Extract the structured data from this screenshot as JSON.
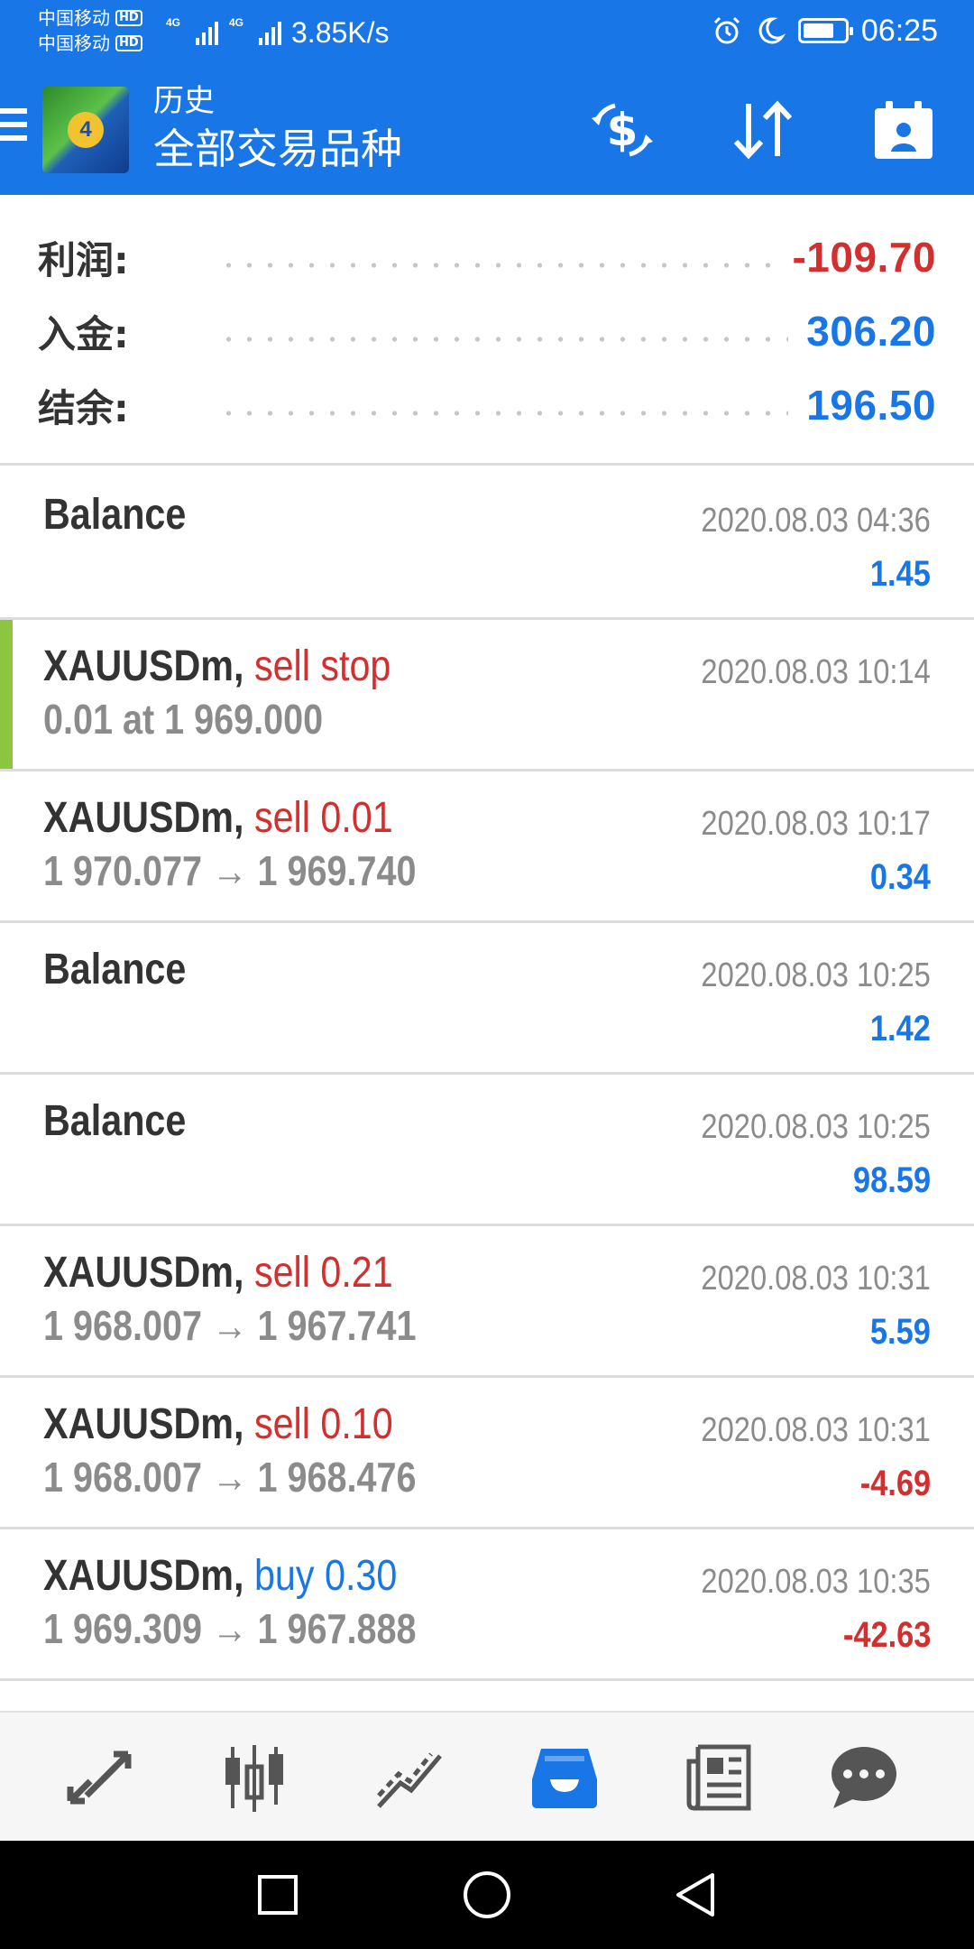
{
  "status_bar": {
    "carrier_1": "中国移动",
    "carrier_2": "中国移动",
    "hd_badge": "HD",
    "network_1": "4G",
    "network_2": "4G",
    "net_speed": "3.85K/s",
    "time": "06:25",
    "battery_level": 0.75,
    "icons": [
      "alarm-icon",
      "moon-icon",
      "battery-icon"
    ]
  },
  "app_bar": {
    "subtitle": "历史",
    "title": "全部交易品种",
    "logo_text": "4",
    "icons": [
      "menu-icon",
      "deposit-icon",
      "sort-icon",
      "period-icon"
    ]
  },
  "summary": {
    "rows": [
      {
        "label": "利润:",
        "value": "-109.70",
        "color": "#d32f2f"
      },
      {
        "label": "入金:",
        "value": "306.20",
        "color": "#1976e6"
      },
      {
        "label": "结余:",
        "value": "196.50",
        "color": "#1976e6"
      }
    ]
  },
  "colors": {
    "accent_blue": "#1976e6",
    "loss_red": "#d32f2f",
    "pending_green": "#8cc63f",
    "muted_gray": "#8b8b8b"
  },
  "deals": [
    {
      "type": "balance",
      "symbol": "Balance",
      "action": "",
      "detail": "",
      "time": "2020.08.03 04:36",
      "profit": "1.45",
      "profit_color": "#1976e6",
      "action_color": ""
    },
    {
      "type": "order",
      "symbol": "XAUUSDm,",
      "action": "sell stop",
      "detail": "0.01 at 1 969.000",
      "time": "2020.08.03 10:14",
      "profit": "",
      "profit_color": "",
      "action_color": "#d32f2f"
    },
    {
      "type": "deal",
      "symbol": "XAUUSDm,",
      "action": "sell 0.01",
      "detail": "1 970.077 → 1 969.740",
      "time": "2020.08.03 10:17",
      "profit": "0.34",
      "profit_color": "#1976e6",
      "action_color": "#d32f2f"
    },
    {
      "type": "balance",
      "symbol": "Balance",
      "action": "",
      "detail": "",
      "time": "2020.08.03 10:25",
      "profit": "1.42",
      "profit_color": "#1976e6",
      "action_color": ""
    },
    {
      "type": "balance",
      "symbol": "Balance",
      "action": "",
      "detail": "",
      "time": "2020.08.03 10:25",
      "profit": "98.59",
      "profit_color": "#1976e6",
      "action_color": ""
    },
    {
      "type": "deal",
      "symbol": "XAUUSDm,",
      "action": "sell 0.21",
      "detail": "1 968.007 → 1 967.741",
      "time": "2020.08.03 10:31",
      "profit": "5.59",
      "profit_color": "#1976e6",
      "action_color": "#d32f2f"
    },
    {
      "type": "deal",
      "symbol": "XAUUSDm,",
      "action": "sell 0.10",
      "detail": "1 968.007 → 1 968.476",
      "time": "2020.08.03 10:31",
      "profit": "-4.69",
      "profit_color": "#d32f2f",
      "action_color": "#d32f2f"
    },
    {
      "type": "deal",
      "symbol": "XAUUSDm,",
      "action": "buy 0.30",
      "detail": "1 969.309 → 1 967.888",
      "time": "2020.08.03 10:35",
      "profit": "-42.63",
      "profit_color": "#d32f2f",
      "action_color": "#1976e6"
    }
  ],
  "bottom_nav": {
    "items": [
      {
        "name": "quotes",
        "icon": "quotes-arrows-icon",
        "active": false
      },
      {
        "name": "chart",
        "icon": "candlestick-icon",
        "active": false
      },
      {
        "name": "trade",
        "icon": "trade-line-icon",
        "active": false
      },
      {
        "name": "history",
        "icon": "inbox-icon",
        "active": true
      },
      {
        "name": "news",
        "icon": "newspaper-icon",
        "active": false
      },
      {
        "name": "messages",
        "icon": "chat-bubble-icon",
        "active": false
      }
    ]
  },
  "system_nav": {
    "icons": [
      "recent-apps-icon",
      "home-icon",
      "back-icon"
    ]
  }
}
